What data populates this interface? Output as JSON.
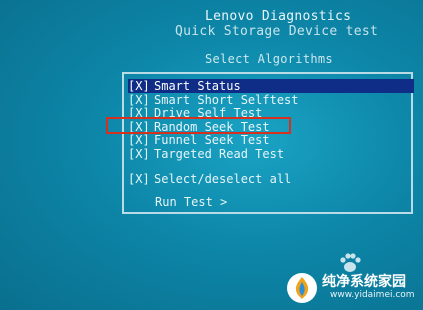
{
  "header": {
    "title": "Lenovo Diagnostics",
    "subtitle": "Quick Storage Device test",
    "section": "Select Algorithms"
  },
  "algorithms": [
    {
      "checkbox": "[X]",
      "label": "Smart Status",
      "selected": true
    },
    {
      "checkbox": "[X]",
      "label": "Smart Short Selftest",
      "selected": false
    },
    {
      "checkbox": "[X]",
      "label": "Drive Self Test",
      "selected": false
    },
    {
      "checkbox": "[X]",
      "label": "Random Seek Test",
      "selected": false
    },
    {
      "checkbox": "[X]",
      "label": "Funnel Seek Test",
      "selected": false
    },
    {
      "checkbox": "[X]",
      "label": "Targeted Read Test",
      "selected": false
    }
  ],
  "select_all": {
    "checkbox": "[X]",
    "label": "Select/deselect all"
  },
  "run_test": "Run Test >",
  "colors": {
    "background": "#0d86a8",
    "selection": "#0f2c86",
    "annotation_box": "#d6311f"
  },
  "watermark": {
    "name": "纯净系统家园",
    "url": "www.yidaimei.com"
  }
}
